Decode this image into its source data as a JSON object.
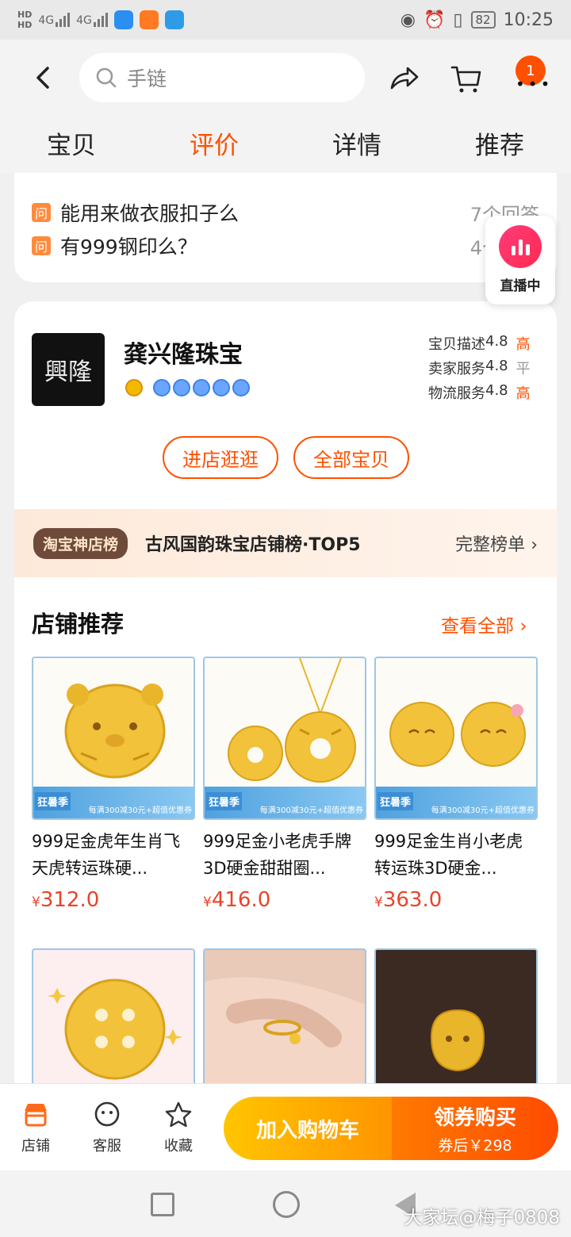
{
  "status": {
    "signal1": "4G",
    "signal2": "4G",
    "battery": "82",
    "time": "10:25"
  },
  "search": {
    "placeholder": "手链"
  },
  "header": {
    "cart_badge": "1"
  },
  "tabs": [
    {
      "label": "宝贝"
    },
    {
      "label": "评价"
    },
    {
      "label": "详情"
    },
    {
      "label": "推荐"
    }
  ],
  "qa": {
    "mark": "问",
    "items": [
      {
        "question": "能用来做衣服扣子么",
        "answers": "7个回答"
      },
      {
        "question": "有999钢印么？",
        "answers": "4个回答"
      }
    ]
  },
  "live": {
    "label": "直播中"
  },
  "shop": {
    "name": "龚兴隆珠宝",
    "logo_text": "興隆",
    "scores": [
      {
        "label": "宝贝描述",
        "value": "4.8",
        "level": "高"
      },
      {
        "label": "卖家服务",
        "value": "4.8",
        "level": "平"
      },
      {
        "label": "物流服务",
        "value": "4.8",
        "level": "高"
      }
    ],
    "btn_visit": "进店逛逛",
    "btn_all": "全部宝贝"
  },
  "ranking": {
    "badge": "淘宝神店榜",
    "title": "古风国韵珠宝店铺榜·TOP5",
    "link": "完整榜单"
  },
  "recommend": {
    "title": "店铺推荐",
    "view_all": "查看全部",
    "products": [
      {
        "name": "999足金虎年生肖飞天虎转运珠硬...",
        "currency": "¥",
        "price": "312.0",
        "tag": "狂暑季",
        "promo": "每满300减30元+超值优惠券"
      },
      {
        "name": "999足金小老虎手牌3D硬金甜甜圈...",
        "currency": "¥",
        "price": "416.0",
        "tag": "狂暑季",
        "promo": "每满300减30元+超值优惠券"
      },
      {
        "name": "999足金生肖小老虎转运珠3D硬金...",
        "currency": "¥",
        "price": "363.0",
        "tag": "狂暑季",
        "promo": "每满300减30元+超值优惠券"
      }
    ]
  },
  "bottom": {
    "shop": "店铺",
    "service": "客服",
    "favorite": "收藏",
    "add_cart": "加入购物车",
    "buy": "领券购买",
    "after_coupon": "券后￥298"
  },
  "watermark": "大家坛@梅子0808"
}
